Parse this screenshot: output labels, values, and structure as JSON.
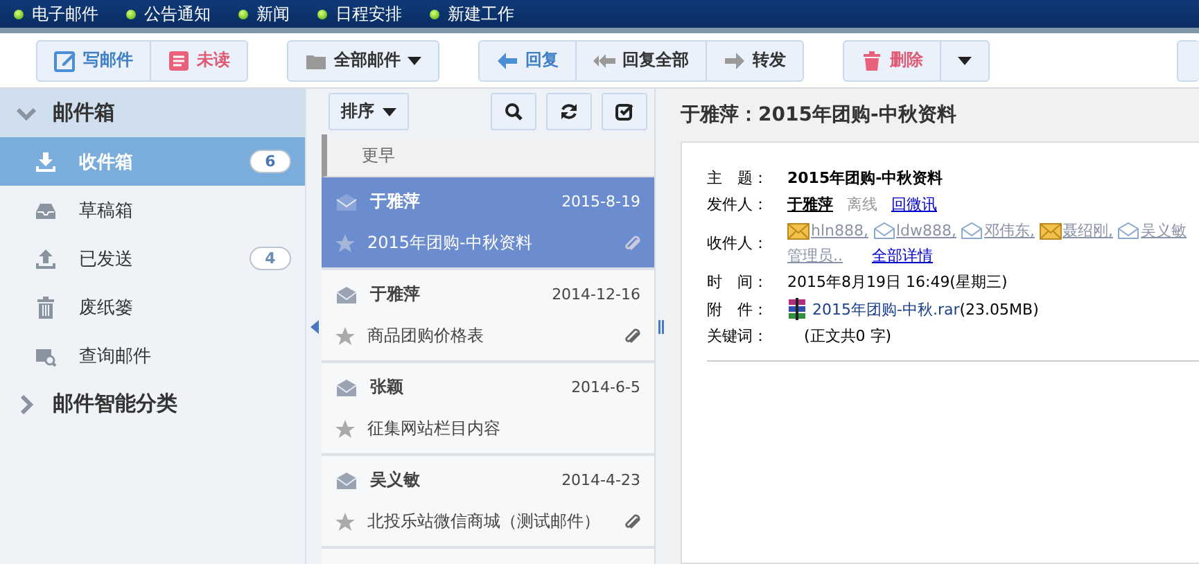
{
  "top_nav": [
    "电子邮件",
    "公告通知",
    "新闻",
    "日程安排",
    "新建工作"
  ],
  "toolbar": {
    "groups": [
      [
        {
          "label": "写邮件",
          "kind": "compose"
        },
        {
          "label": "未读",
          "kind": "unread"
        }
      ],
      [
        {
          "label": "全部邮件",
          "kind": "folder",
          "dropdown": true
        }
      ],
      [
        {
          "label": "回复",
          "kind": "reply"
        },
        {
          "label": "回复全部",
          "kind": "reply-all"
        },
        {
          "label": "转发",
          "kind": "forward"
        }
      ],
      [
        {
          "label": "删除",
          "kind": "delete"
        },
        {
          "kind": "caret"
        }
      ]
    ]
  },
  "sidebar": {
    "sections": [
      {
        "title": "邮件箱",
        "expanded": true,
        "items": [
          {
            "label": "收件箱",
            "kind": "inbox",
            "selected": true,
            "count": "6"
          },
          {
            "label": "草稿箱",
            "kind": "drafts",
            "selected": false
          },
          {
            "label": "已发送",
            "kind": "sent",
            "selected": false,
            "count": "4"
          },
          {
            "label": "废纸篓",
            "kind": "trash",
            "selected": false
          },
          {
            "label": "查询邮件",
            "kind": "search",
            "selected": false
          }
        ]
      },
      {
        "title": "邮件智能分类",
        "expanded": false
      }
    ]
  },
  "list": {
    "sort_label": "排序",
    "group": "更早",
    "messages": [
      {
        "sender": "于雅萍",
        "date": "2015-8-19",
        "subject": "2015年团购-中秋资料",
        "attachment": true,
        "selected": true
      },
      {
        "sender": "于雅萍",
        "date": "2014-12-16",
        "subject": "商品团购价格表",
        "attachment": true,
        "selected": false
      },
      {
        "sender": "张颖",
        "date": "2014-6-5",
        "subject": "征集网站栏目内容",
        "attachment": false,
        "selected": false
      },
      {
        "sender": "吴义敏",
        "date": "2014-4-23",
        "subject": "北投乐站微信商城（测试邮件）",
        "attachment": true,
        "selected": false
      }
    ]
  },
  "reader": {
    "title": "于雅萍：2015年团购-中秋资料",
    "subject_label": "主　题：",
    "subject": "2015年团购-中秋资料",
    "from_label": "发件人：",
    "from": "于雅萍",
    "from_status": "离线",
    "from_link": "回微讯",
    "to_label": "收件人：",
    "recipients": [
      {
        "name": "hln888,",
        "kind": "unread"
      },
      {
        "name": "ldw888,",
        "kind": "read"
      },
      {
        "name": "邓伟东,",
        "kind": "read"
      },
      {
        "name": "聂绍刚,",
        "kind": "unread"
      },
      {
        "name": "吴义敏",
        "kind": "read"
      },
      {
        "name": "管理员..",
        "kind": "none"
      }
    ],
    "to_link": "全部详情",
    "time_label": "时　间：",
    "time": "2015年8月19日 16:49(星期三)",
    "attach_label": "附　件：",
    "attach_name": "2015年团购-中秋.rar",
    "attach_size": "(23.05MB)",
    "keywords_label": "关键词：",
    "keywords": "(正文共0 字)"
  }
}
